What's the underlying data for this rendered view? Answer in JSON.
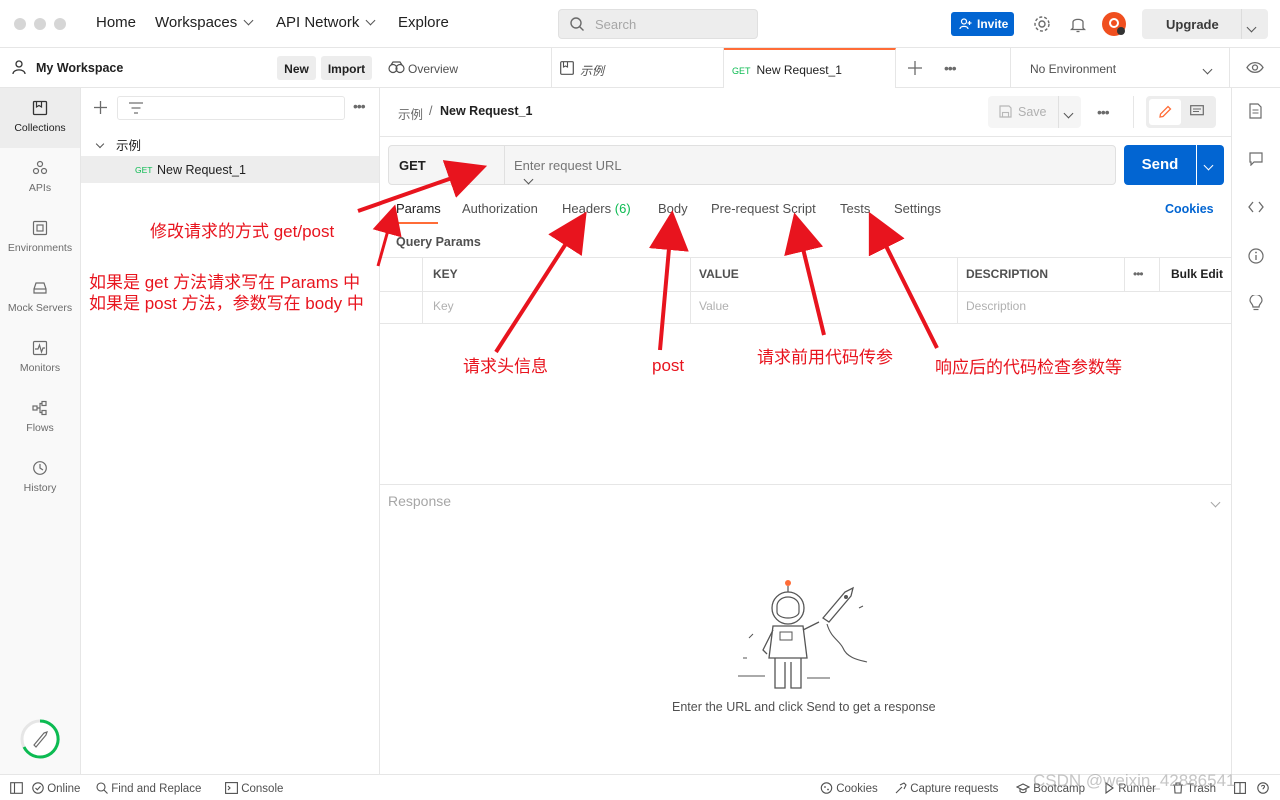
{
  "topbar": {
    "nav": [
      "Home",
      "Workspaces",
      "API Network",
      "Explore"
    ],
    "search_placeholder": "Search",
    "invite_label": "Invite",
    "upgrade_label": "Upgrade"
  },
  "workspace": {
    "name": "My Workspace",
    "new_label": "New",
    "import_label": "Import"
  },
  "rail": [
    {
      "label": "Collections",
      "icon": "collections-icon",
      "active": true
    },
    {
      "label": "APIs",
      "icon": "apis-icon"
    },
    {
      "label": "Environments",
      "icon": "environments-icon"
    },
    {
      "label": "Mock Servers",
      "icon": "mock-servers-icon"
    },
    {
      "label": "Monitors",
      "icon": "monitors-icon"
    },
    {
      "label": "Flows",
      "icon": "flows-icon"
    },
    {
      "label": "History",
      "icon": "history-icon"
    }
  ],
  "sidebar": {
    "collection_name": "示例",
    "request_method": "GET",
    "request_name": "New Request_1"
  },
  "tabs": {
    "overview": "Overview",
    "collection": "示例",
    "active_method": "GET",
    "active_name": "New Request_1",
    "environment": "No Environment"
  },
  "request": {
    "breadcrumb_parent": "示例",
    "breadcrumb_sep": "/",
    "breadcrumb_current": "New Request_1",
    "save_label": "Save",
    "method": "GET",
    "url_placeholder": "Enter request URL",
    "send_label": "Send",
    "tabs": {
      "params": "Params",
      "authorization": "Authorization",
      "headers": "Headers",
      "headers_count": "(6)",
      "body": "Body",
      "prerequest": "Pre-request Script",
      "tests": "Tests",
      "settings": "Settings"
    },
    "cookies_label": "Cookies",
    "query_params_title": "Query Params",
    "table": {
      "headers": [
        "KEY",
        "VALUE",
        "DESCRIPTION"
      ],
      "bulk_edit": "Bulk Edit",
      "placeholders": [
        "Key",
        "Value",
        "Description"
      ]
    }
  },
  "response": {
    "title": "Response",
    "empty_message": "Enter the URL and click Send to get a response"
  },
  "statusbar": {
    "online": "Online",
    "find_replace": "Find and Replace",
    "console": "Console",
    "cookies": "Cookies",
    "capture": "Capture requests",
    "bootcamp": "Bootcamp",
    "runner": "Runner",
    "trash": "Trash"
  },
  "annotations": {
    "method_note": "修改请求的方式 get/post",
    "params_note_line1": "如果是 get 方法请求写在 Params 中",
    "params_note_line2": "如果是 post 方法，参数写在 body 中",
    "headers_note": "请求头信息",
    "body_note": "post",
    "prerequest_note": "请求前用代码传参",
    "tests_note": "响应后的代码检查参数等"
  },
  "watermark": "CSDN @weixin_42886541",
  "colors": {
    "accent_orange": "#ff6c37",
    "primary_blue": "#0265d2",
    "get_green": "#0cbb52",
    "annotation_red": "#e8141e"
  }
}
